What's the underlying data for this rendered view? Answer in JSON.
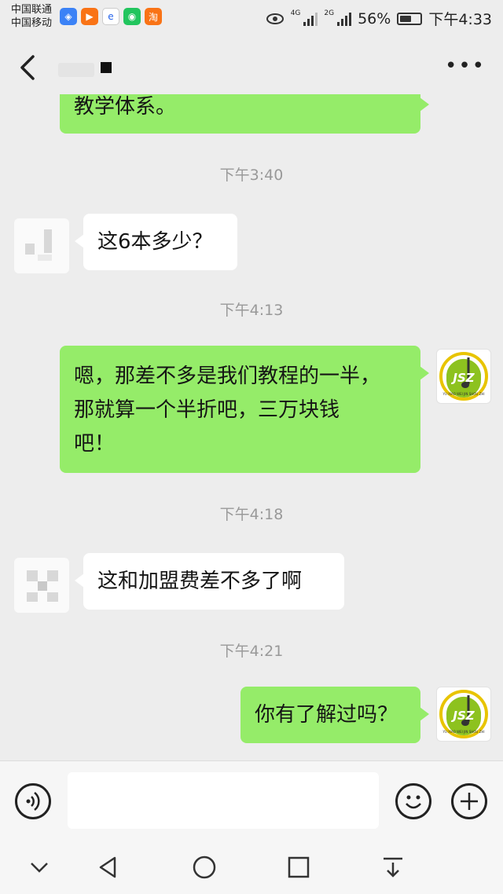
{
  "status_bar": {
    "carrier_1": "中国联通",
    "carrier_2": "中国移动",
    "net_1": "4G",
    "net_2": "2G",
    "battery": "56%",
    "time": "下午4:33"
  },
  "header": {
    "back_icon": "chevron-left-icon",
    "more_icon": "more-horizontal-icon"
  },
  "messages": {
    "m0": {
      "side": "sent",
      "text": "教学体系。"
    },
    "t1": "下午3:40",
    "m1": {
      "side": "received",
      "text": "这6本多少？"
    },
    "t2": "下午4:13",
    "m2": {
      "side": "sent",
      "lines": [
        "嗯，那差不多是我们教程的一半，",
        "那就算一个半折吧，三万块钱",
        "吧！"
      ]
    },
    "t3": "下午4:18",
    "m3": {
      "side": "received",
      "text": "这和加盟费差不多了啊"
    },
    "t4": "下午4:21",
    "m4": {
      "side": "sent",
      "text": "你有了解过吗？"
    }
  },
  "my_avatar": {
    "logo_text": "JSZ",
    "logo_subtext": "YU XIAO WEI JIN SHOU ZHI"
  },
  "input_bar": {
    "voice_icon": "voice-icon",
    "emoji_icon": "emoji-icon",
    "plus_icon": "plus-circle-icon",
    "input_value": ""
  },
  "colors": {
    "sent_bubble": "#95ec69",
    "received_bubble": "#ffffff",
    "background": "#ededed",
    "logo_green": "#8dc21f",
    "logo_ring": "#e8c400"
  }
}
